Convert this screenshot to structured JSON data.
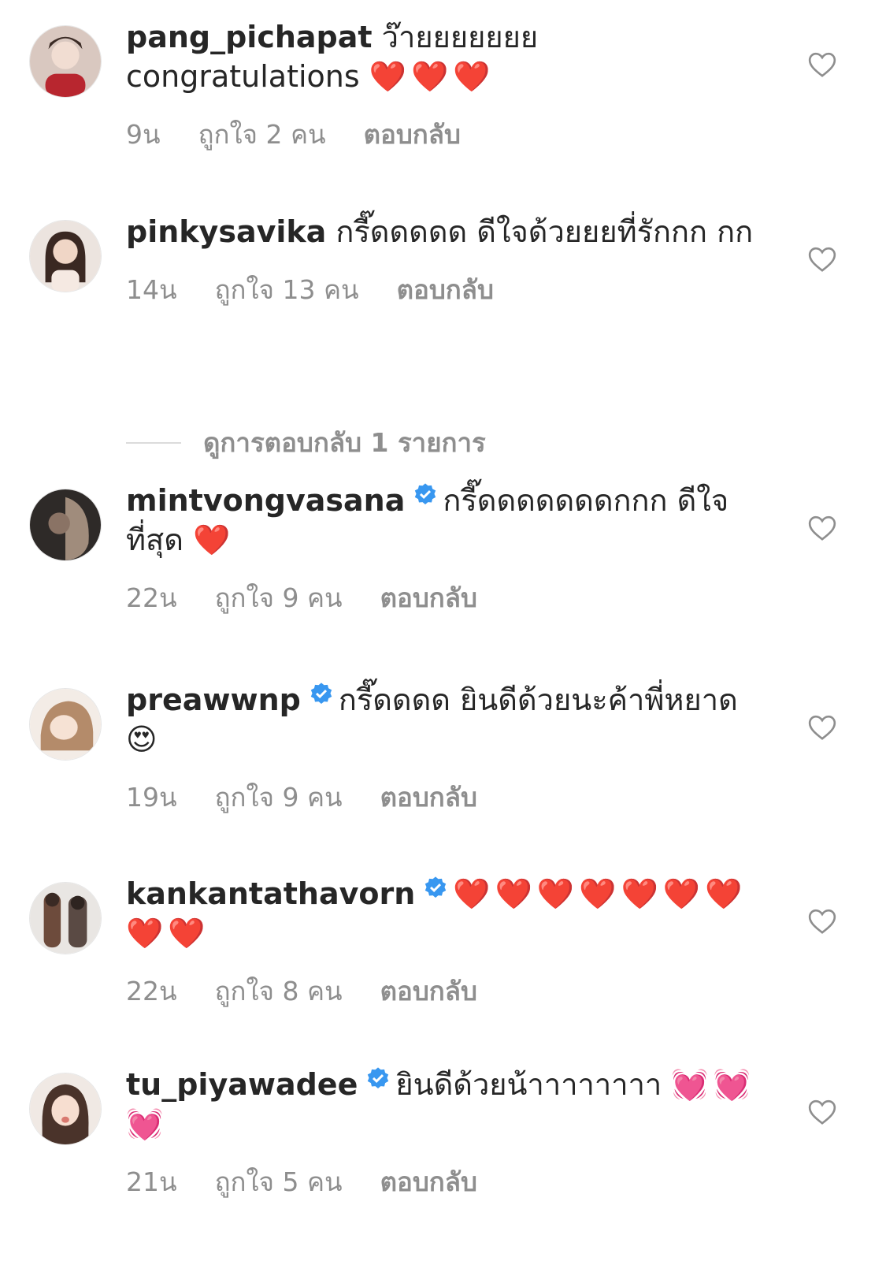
{
  "comments": [
    {
      "username": "pang_pichapat",
      "verified": false,
      "text": "ว๊ายยยยยยย congratulations",
      "emoji": "❤️❤️❤️",
      "emoji_class": "heart-red",
      "time": "9น",
      "likes": "ถูกใจ 2 คน",
      "reply": "ตอบกลับ"
    },
    {
      "username": "pinkysavika",
      "verified": false,
      "text": "กรี๊ดดดดด ดีใจด้วยยยที่รักกก กก",
      "emoji": "",
      "emoji_class": "",
      "time": "14น",
      "likes": "ถูกใจ 13 คน",
      "reply": "ตอบกลับ"
    },
    {
      "username": "mintvongvasana",
      "verified": true,
      "text": "กรี๊ดดดดดดดกกก ดีใจที่สุด",
      "emoji": "❤️",
      "emoji_class": "heart-red",
      "time": "22น",
      "likes": "ถูกใจ 9 คน",
      "reply": "ตอบกลับ"
    },
    {
      "username": "preawwnp",
      "verified": true,
      "text": "กรี๊ดดดด ยินดีด้วยนะค้าพี่หยาด",
      "emoji": "😍",
      "emoji_class": "",
      "time": "19น",
      "likes": "ถูกใจ 9 คน",
      "reply": "ตอบกลับ"
    },
    {
      "username": "kankantathavorn",
      "verified": true,
      "text": "",
      "emoji": "❤️❤️❤️❤️❤️❤️❤️❤️❤️",
      "emoji_class": "heart-red",
      "time": "22น",
      "likes": "ถูกใจ 8 คน",
      "reply": "ตอบกลับ"
    },
    {
      "username": "tu_piyawadee",
      "verified": true,
      "text": "ยินดีด้วยน้าาาาาาาา",
      "emoji": "💓💓💓",
      "emoji_class": "heart-pink",
      "time": "21น",
      "likes": "ถูกใจ 5 คน",
      "reply": "ตอบกลับ"
    }
  ],
  "view_replies": "ดูการตอบกลับ 1 รายการ",
  "icons": {
    "like": "heart-outline-icon",
    "verified": "verified-badge-icon"
  },
  "colors": {
    "text": "#262626",
    "meta": "#8e8e8e",
    "verified": "#3897f0",
    "divider": "#dbdbdb"
  }
}
